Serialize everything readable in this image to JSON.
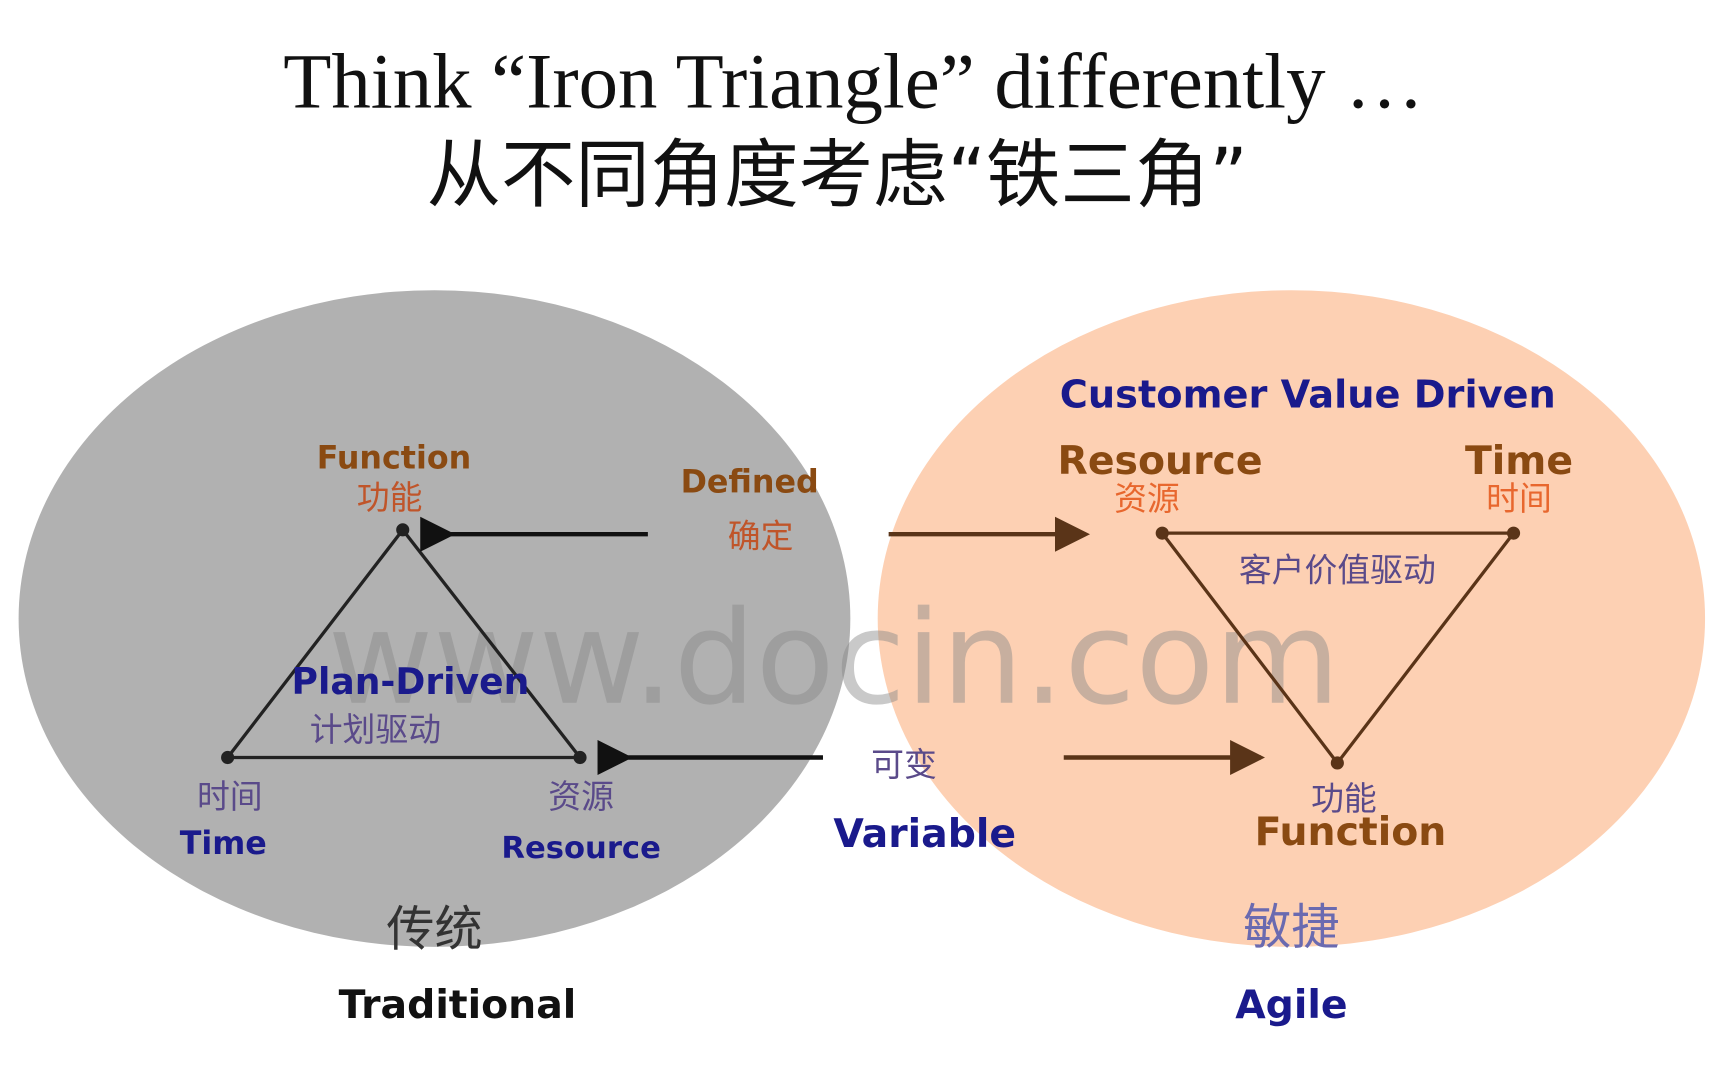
{
  "title": {
    "english": "Think “Iron Triangle” differently …",
    "chinese": "从不同角度考虑“铁三角”"
  },
  "colors": {
    "traditional_bg": "#b1b1b1",
    "agile_bg": "#fdd0b3",
    "navy": "#1a1a8c",
    "brown": "#8a4a12",
    "orange": "#e8672e",
    "purple": "#5a4a8a"
  },
  "traditional": {
    "function_en": "Function",
    "function_zh": "功能",
    "time_zh": "时间",
    "time_en": "Time",
    "resource_zh": "资源",
    "resource_en": "Resource",
    "center_en": "Plan-Driven",
    "center_zh": "计划驱动",
    "label_zh": "传统",
    "label_en": "Traditional"
  },
  "middle": {
    "defined_en": "Defined",
    "defined_zh": "确定",
    "variable_zh": "可变",
    "variable_en": "Variable"
  },
  "agile": {
    "heading": "Customer Value Driven",
    "resource_en": "Resource",
    "resource_zh": "资源",
    "time_en": "Time",
    "time_zh": "时间",
    "center_zh": "客户价值驱动",
    "function_zh": "功能",
    "function_en": "Function",
    "label_zh": "敏捷",
    "label_en": "Agile"
  },
  "watermark": "www.docin.com"
}
